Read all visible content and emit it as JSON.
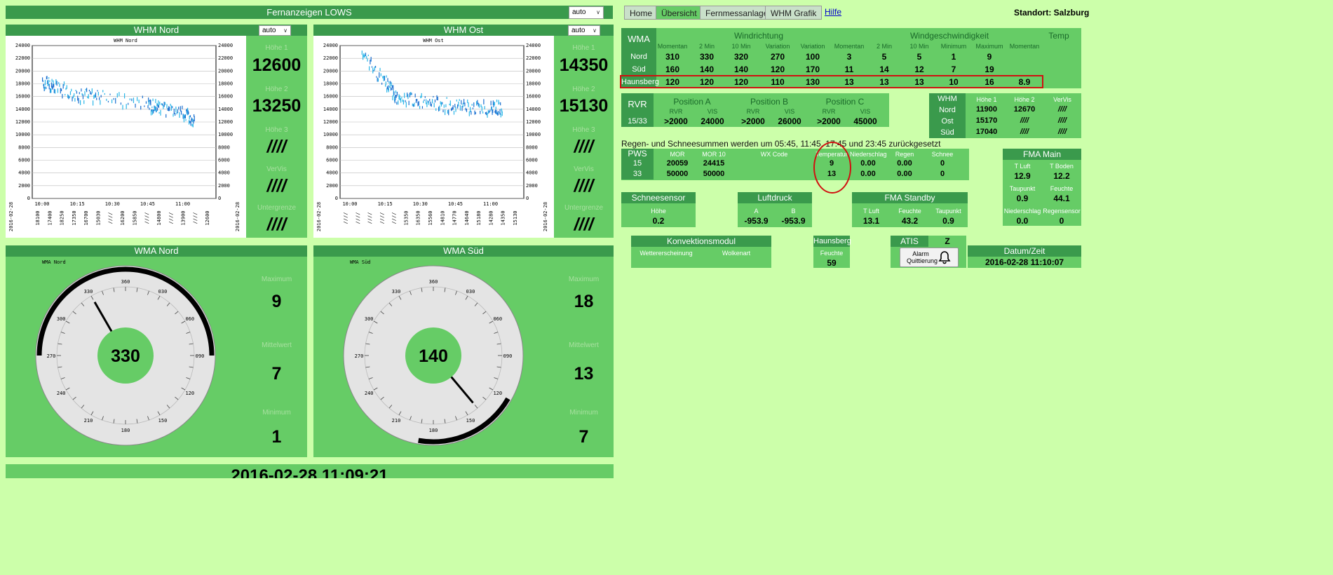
{
  "header": {
    "title": "Fernanzeigen LOWS",
    "mode": "auto"
  },
  "whm_nord": {
    "title": "WHM Nord",
    "mode": "auto",
    "chart_title": "WHM Nord",
    "side": [
      {
        "label": "Höhe 1",
        "value": "12600"
      },
      {
        "label": "Höhe 2",
        "value": "13250"
      },
      {
        "label": "Höhe 3",
        "value": "////"
      },
      {
        "label": "VerVis",
        "value": "////"
      },
      {
        "label": "Untergrenze",
        "value": "////"
      }
    ],
    "bottom_labels": [
      "18100",
      "17400",
      "18250",
      "17350",
      "16700",
      "15030",
      "////",
      "16200",
      "15850",
      "////",
      "14800",
      "////",
      "13900",
      "////",
      "12600"
    ]
  },
  "whm_ost": {
    "title": "WHM Ost",
    "mode": "auto",
    "chart_title": "WHM Ost",
    "side": [
      {
        "label": "Höhe 1",
        "value": "14350"
      },
      {
        "label": "Höhe 2",
        "value": "15130"
      },
      {
        "label": "Höhe 3",
        "value": "////"
      },
      {
        "label": "VerVis",
        "value": "////"
      },
      {
        "label": "Untergrenze",
        "value": "////"
      }
    ],
    "bottom_labels": [
      "////",
      "////",
      "////",
      "////",
      "////",
      "15350",
      "16350",
      "15560",
      "14810",
      "14770",
      "14640",
      "15180",
      "14280",
      "14350",
      "15130"
    ]
  },
  "chart_data": [
    {
      "type": "scatter",
      "title": "WHM Nord",
      "ylim": [
        0,
        24000
      ],
      "yticks": [
        "24000",
        "22000",
        "20000",
        "18000",
        "16000",
        "14000",
        "12000",
        "10000",
        "8000",
        "6000",
        "4000",
        "2000",
        "0"
      ],
      "xticks": [
        "10:00",
        "10:15",
        "10:30",
        "10:45",
        "11:00"
      ],
      "xdate": "2016-02-28",
      "series": [
        {
          "x": [
            "10:00",
            "10:05",
            "10:15",
            "10:25",
            "10:45",
            "10:50",
            "11:00",
            "11:05"
          ],
          "y": [
            18500,
            18000,
            16500,
            16000,
            15000,
            14500,
            13500,
            12600
          ]
        }
      ]
    },
    {
      "type": "scatter",
      "title": "WHM Ost",
      "ylim": [
        0,
        24000
      ],
      "yticks": [
        "24000",
        "22000",
        "20000",
        "18000",
        "16000",
        "14000",
        "12000",
        "10000",
        "8000",
        "6000",
        "4000",
        "2000",
        "0"
      ],
      "xticks": [
        "10:00",
        "10:15",
        "10:30",
        "10:45",
        "11:00"
      ],
      "xdate": "2016-02-28",
      "series": [
        {
          "x": [
            "10:05",
            "10:15",
            "10:20",
            "10:30",
            "10:40",
            "10:50",
            "11:00",
            "11:05"
          ],
          "y": [
            23000,
            18500,
            16000,
            15500,
            15000,
            14500,
            14500,
            14350
          ]
        }
      ]
    }
  ],
  "wma_nord": {
    "title": "WMA Nord",
    "chart_title": "WMA Nord",
    "center": "330",
    "labels": [
      "Maximum",
      "Mittelwert",
      "Minimum"
    ],
    "values": [
      "9",
      "7",
      "1"
    ],
    "dir": 330,
    "arc": [
      270,
      90
    ],
    "ticks": [
      "360",
      "030",
      "060",
      "090",
      "120",
      "150",
      "180",
      "210",
      "240",
      "270",
      "300",
      "330"
    ]
  },
  "wma_sued": {
    "title": "WMA Süd",
    "chart_title": "WMA Süd",
    "center": "140",
    "labels": [
      "Maximum",
      "Mittelwert",
      "Minimum"
    ],
    "values": [
      "18",
      "13",
      "7"
    ],
    "dir": 140,
    "arc": [
      120,
      190
    ],
    "ticks": [
      "360",
      "030",
      "060",
      "090",
      "120",
      "150",
      "180",
      "210",
      "240",
      "270",
      "300",
      "330"
    ]
  },
  "footer_time": "2016-02-28 11:09:21",
  "nav": {
    "home": "Home",
    "uebersicht": "Übersicht",
    "fernmess": "Fernmessanlage",
    "whm": "WHM Grafik",
    "hilfe": "Hilfe",
    "standort": "Standort: Salzburg"
  },
  "wma_table": {
    "title": "WMA",
    "wind_dir": "Windrichtung",
    "wind_speed": "Windgeschwindigkeit",
    "temp": "Temp",
    "cols": [
      "Momentan",
      "2 Min",
      "10 Min",
      "Variation",
      "Variation",
      "Momentan",
      "2 Min",
      "10 Min",
      "Minimum",
      "Maximum",
      "Momentan"
    ],
    "rows": [
      {
        "name": "Nord",
        "v": [
          "310",
          "330",
          "320",
          "270",
          "100",
          "3",
          "5",
          "5",
          "1",
          "9",
          ""
        ]
      },
      {
        "name": "Süd",
        "v": [
          "160",
          "140",
          "140",
          "120",
          "170",
          "11",
          "14",
          "12",
          "7",
          "19",
          ""
        ]
      },
      {
        "name": "Haunsberg",
        "v": [
          "120",
          "120",
          "120",
          "110",
          "130",
          "13",
          "13",
          "13",
          "10",
          "16",
          "8.9"
        ]
      }
    ]
  },
  "rvr": {
    "title": "RVR",
    "rwy": "15/33",
    "pos": [
      "Position A",
      "Position B",
      "Position C"
    ],
    "sub": [
      "RVR",
      "VIS",
      "RVR",
      "VIS",
      "RVR",
      "VIS"
    ],
    "vals": [
      ">2000",
      "24000",
      ">2000",
      "26000",
      ">2000",
      "45000"
    ]
  },
  "whm_table": {
    "title": "WHM",
    "cols": [
      "Höhe 1",
      "Höhe 2",
      "VerVis"
    ],
    "rows": [
      {
        "name": "Nord",
        "v": [
          "11900",
          "12670",
          "////"
        ]
      },
      {
        "name": "Ost",
        "v": [
          "15170",
          "////",
          "////"
        ]
      },
      {
        "name": "Süd",
        "v": [
          "17040",
          "////",
          "////"
        ]
      }
    ]
  },
  "notice": "Regen- und Schneesummen werden um 05:45, 11:45, 17:45 und 23:45 zurückgesetzt",
  "pws": {
    "title": "PWS",
    "cols": [
      "MOR",
      "MOR 10",
      "WX Code",
      "Temperatur",
      "Niederschlag",
      "Regen",
      "Schnee"
    ],
    "rows": [
      {
        "name": "15",
        "v": [
          "20059",
          "24415",
          "",
          "9",
          "0.00",
          "0.00",
          "0"
        ]
      },
      {
        "name": "33",
        "v": [
          "50000",
          "50000",
          "",
          "13",
          "0.00",
          "0.00",
          "0"
        ]
      }
    ]
  },
  "fma_main": {
    "title": "FMA Main",
    "l1": [
      "T Luft",
      "T Boden"
    ],
    "v1": [
      "12.9",
      "12.2"
    ],
    "l2": [
      "Taupunkt",
      "Feuchte"
    ],
    "v2": [
      "0.9",
      "44.1"
    ],
    "l3": [
      "Niederschlag",
      "Regensensor"
    ],
    "v3": [
      "0.0",
      "0"
    ]
  },
  "schnee": {
    "title": "Schneesensor",
    "label": "Höhe",
    "value": "0.2"
  },
  "luft": {
    "title": "Luftdruck",
    "labels": [
      "A",
      "B"
    ],
    "values": [
      "-953.9",
      "-953.9"
    ]
  },
  "fma_standby": {
    "title": "FMA Standby",
    "labels": [
      "T Luft",
      "Feuchte",
      "Taupunkt"
    ],
    "values": [
      "13.1",
      "43.2",
      "0.9"
    ]
  },
  "konv": {
    "title": "Konvektionsmodul",
    "labels": [
      "Wettererscheinung",
      "Wolkenart"
    ]
  },
  "haunsberg": {
    "title": "Haunsberg",
    "label": "Feuchte",
    "value": "59"
  },
  "atis": {
    "title": "ATIS",
    "value": "Z",
    "alarm": "Alarm Quittierung"
  },
  "datum": {
    "title": "Datum/Zeit",
    "value": "2016-02-28 11:10:07"
  }
}
